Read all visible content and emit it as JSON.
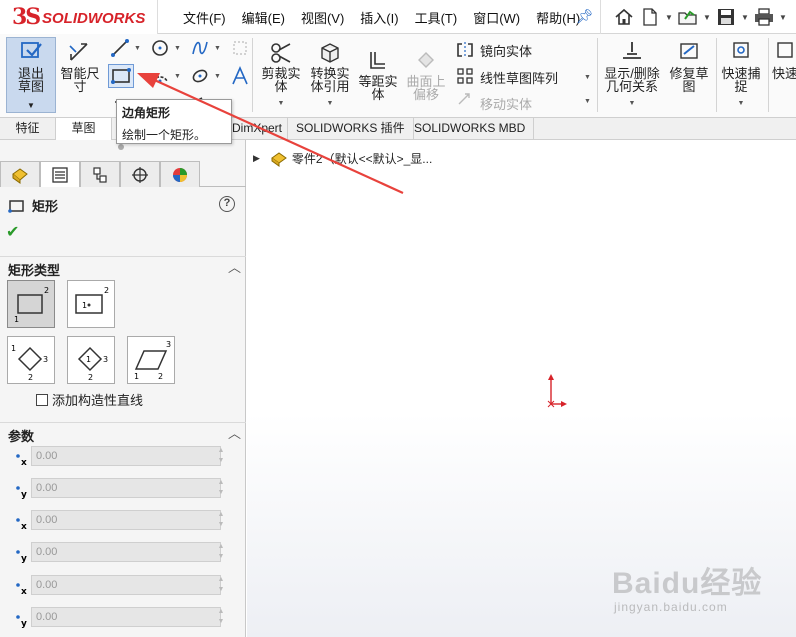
{
  "app": {
    "logo_mark": "3S",
    "logo_text": "SOLIDWORKS"
  },
  "menu": [
    "文件(F)",
    "编辑(E)",
    "视图(V)",
    "插入(I)",
    "工具(T)",
    "窗口(W)",
    "帮助(H)"
  ],
  "ribbon": {
    "exit_sketch": "退出草图",
    "smart_dimension": "智能尺寸",
    "trim_entities": "剪裁实体",
    "convert_entities": "转换实体引用",
    "offset_entities": "等距实体",
    "offset_on_surface": "曲面上偏移",
    "mirror_entities": "镜向实体",
    "linear_pattern": "线性草图阵列",
    "move_entities": "移动实体",
    "display_delete_relations": "显示/删除几何关系",
    "repair_sketch": "修复草图",
    "quick_snaps": "快速捕捉",
    "quick_partial": "快速"
  },
  "tabs": {
    "feature": "特征",
    "sketch": "草图",
    "dimxpert": "DimXpert",
    "sw_addins": "SOLIDWORKS 插件",
    "sw_mbd": "SOLIDWORKS MBD"
  },
  "tooltip": {
    "title": "边角矩形",
    "desc": "绘制一个矩形。"
  },
  "panel": {
    "title": "矩形",
    "help": "?",
    "rect_type_header": "矩形类型",
    "add_construction": "添加构造性直线",
    "params_header": "参数",
    "params": [
      {
        "axis": "x",
        "value": "0.00"
      },
      {
        "axis": "y",
        "value": "0.00"
      },
      {
        "axis": "x",
        "value": "0.00"
      },
      {
        "axis": "y",
        "value": "0.00"
      },
      {
        "axis": "x",
        "value": "0.00"
      },
      {
        "axis": "y",
        "value": "0.00"
      }
    ]
  },
  "tree": {
    "root": "零件2（默认<<默认>_显..."
  },
  "watermark": {
    "big": "Baidu经验",
    "small": "jingyan.baidu.com"
  },
  "colors": {
    "brand": "#d7232a",
    "accent": "#2468c4",
    "arrow": "#e8423c"
  }
}
